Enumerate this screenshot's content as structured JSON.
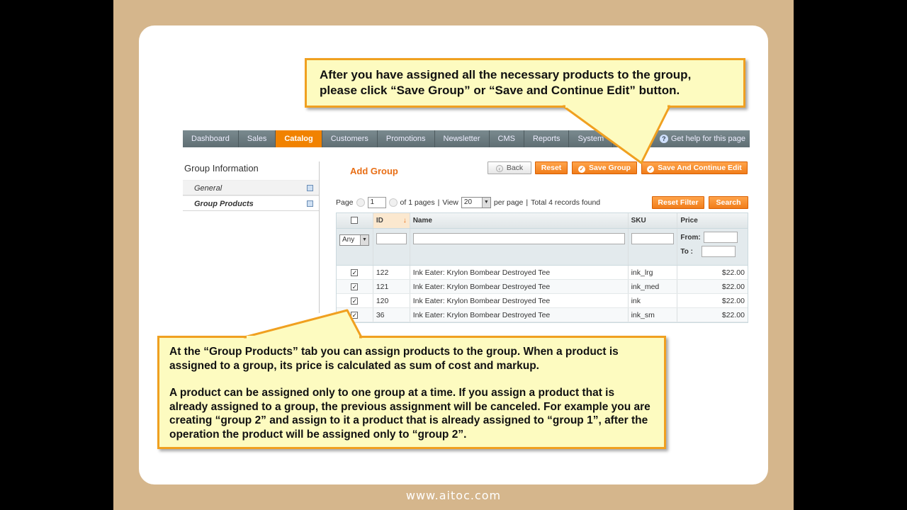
{
  "callouts": {
    "top": "After you have assigned all the necessary products to the group, please click “Save Group” or “Save and Continue Edit” button.",
    "bottom_p1": "At the “Group Products” tab you can assign products to the group. When a product is assigned to a group, its price is calculated as sum of cost and markup.",
    "bottom_p2": "A product can be assigned only to one group at a time. If you assign a product that is already assigned to a group, the previous assignment will be canceled. For example you are creating “group 2” and assign to it a product that is already assigned to “group 1”, after the operation the product will be assigned  only to “group 2”."
  },
  "nav": {
    "items": [
      "Dashboard",
      "Sales",
      "Catalog",
      "Customers",
      "Promotions",
      "Newsletter",
      "CMS",
      "Reports",
      "System"
    ],
    "active": "Catalog",
    "help": "Get help for this page"
  },
  "sidebar": {
    "title": "Group Information",
    "tabs": [
      {
        "label": "General",
        "active": false
      },
      {
        "label": "Group Products",
        "active": true
      }
    ]
  },
  "page": {
    "title": "Add Group",
    "buttons": {
      "back": "Back",
      "reset": "Reset",
      "save_group": "Save Group",
      "save_continue": "Save And Continue Edit",
      "reset_filter": "Reset Filter",
      "search": "Search"
    }
  },
  "pager": {
    "page_label": "Page",
    "page_value": "1",
    "of_pages": "of 1 pages",
    "view_label": "View",
    "view_value": "20",
    "per_page": "per page",
    "total": "Total 4 records found"
  },
  "grid": {
    "headers": {
      "id": "ID",
      "name": "Name",
      "sku": "SKU",
      "price": "Price"
    },
    "filter": {
      "select_value": "Any",
      "from_label": "From:",
      "to_label": "To :"
    },
    "rows": [
      {
        "id": "122",
        "name": "Ink Eater: Krylon Bombear Destroyed Tee",
        "sku": "ink_lrg",
        "price": "$22.00"
      },
      {
        "id": "121",
        "name": "Ink Eater: Krylon Bombear Destroyed Tee",
        "sku": "ink_med",
        "price": "$22.00"
      },
      {
        "id": "120",
        "name": "Ink Eater: Krylon Bombear Destroyed Tee",
        "sku": "ink",
        "price": "$22.00"
      },
      {
        "id": "36",
        "name": "Ink Eater: Krylon Bombear Destroyed Tee",
        "sku": "ink_sm",
        "price": "$22.00"
      }
    ]
  },
  "footer": {
    "url": "www.aitoc.com"
  },
  "colors": {
    "accent": "#f18200",
    "callout_bg": "#fdfbc0",
    "callout_border": "#f0a020",
    "frame": "#d5b68c"
  }
}
